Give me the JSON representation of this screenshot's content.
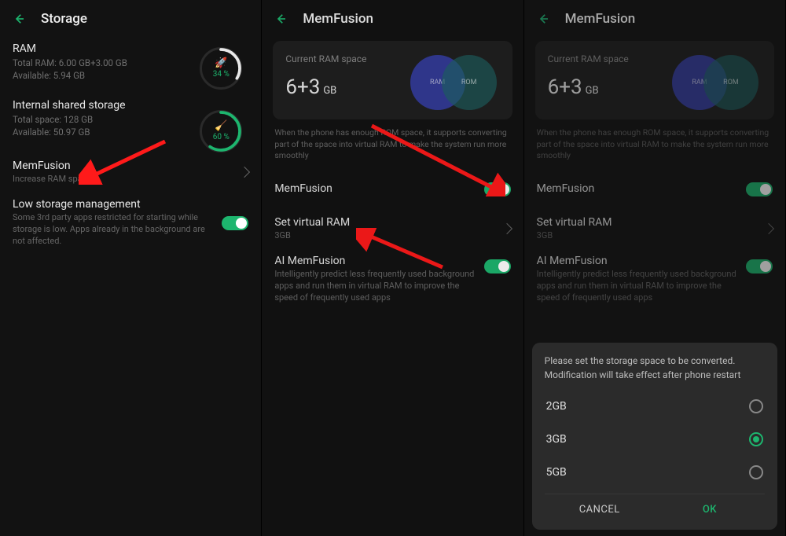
{
  "panel1": {
    "title": "Storage",
    "ram": {
      "title": "RAM",
      "total": "Total RAM: 6.00 GB+3.00 GB",
      "avail": "Available: 5.94 GB",
      "pct": "34 %"
    },
    "internal": {
      "title": "Internal shared storage",
      "total": "Total space: 128 GB",
      "avail": "Available: 50.97 GB",
      "pct": "60 %"
    },
    "memfusion": {
      "title": "MemFusion",
      "sub": "Increase RAM space"
    },
    "lowstorage": {
      "title": "Low storage management",
      "sub": "Some 3rd party apps restricted for starting while storage is low. Apps already in the background are not affected."
    }
  },
  "panel2": {
    "title": "MemFusion",
    "card": {
      "label": "Current RAM space",
      "big": "6+3",
      "unit": "GB",
      "ram": "RAM",
      "rom": "ROM"
    },
    "helper": "When the phone has enough ROM space, it supports converting part of the space into virtual RAM to make the system run more smoothly",
    "mf": "MemFusion",
    "svr": {
      "title": "Set virtual RAM",
      "sub": "3GB"
    },
    "ai": {
      "title": "AI MemFusion",
      "sub": "Intelligently predict less frequently used background apps and run them in virtual RAM to improve the speed of frequently used apps"
    }
  },
  "panel3": {
    "title": "MemFusion",
    "dialog": {
      "msg": "Please set the storage space to be converted. Modification will take effect after phone restart",
      "opts": [
        "2GB",
        "3GB",
        "5GB"
      ],
      "selected": 1,
      "cancel": "CANCEL",
      "ok": "OK"
    }
  }
}
